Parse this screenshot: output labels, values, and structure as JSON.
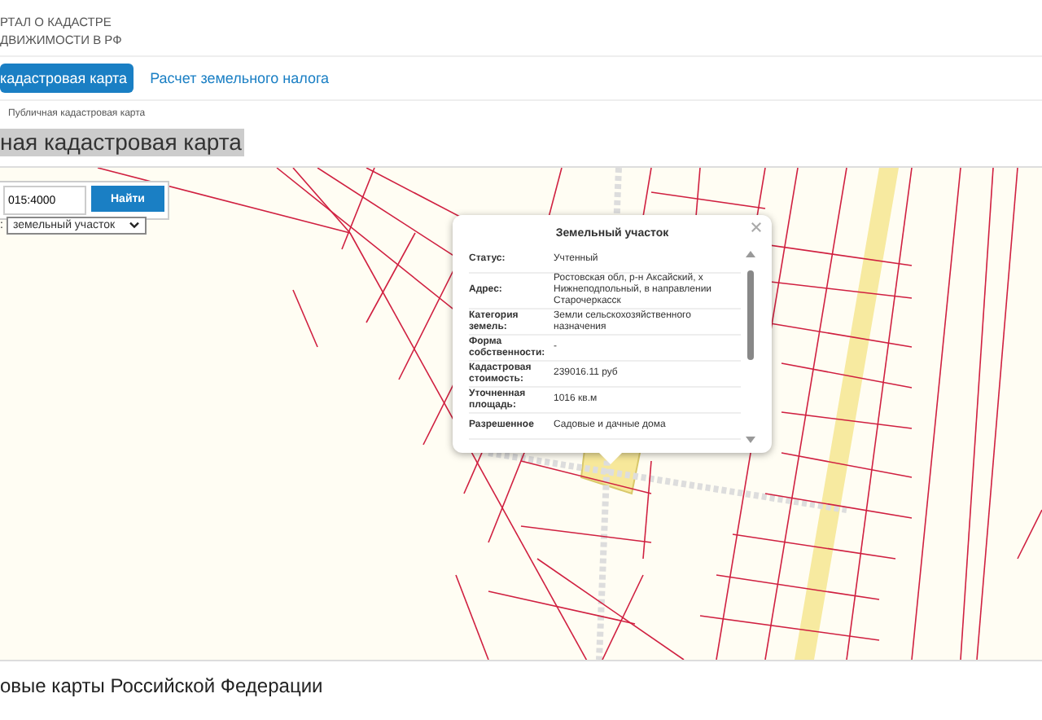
{
  "header": {
    "logo_lines": [
      "РТАЛ О КАДАСТРЕ",
      "ДВИЖИМОСТИ В РФ"
    ]
  },
  "nav": [
    {
      "label": "кадастровая карта",
      "selected": true
    },
    {
      "label": "Расчет земельного налога",
      "selected": false
    }
  ],
  "breadcrumb": "Публичная кадастровая карта",
  "heading": "ная кадастровая карта",
  "search": {
    "value": "015:4000",
    "button": "Найти",
    "select_prefix": ":",
    "select_value": "земельный участок"
  },
  "popup": {
    "title": "Земельный участок",
    "rows": [
      {
        "label": "Статус:",
        "value": "Учтенный"
      },
      {
        "label": "Адрес:",
        "value": "Ростовская обл, р-н Аксайский, х Нижнеподпольный, в направлении Старочеркасск"
      },
      {
        "label": "Категория земель:",
        "value": "Земли сельскохозяйственного назначения"
      },
      {
        "label": "Форма собственности:",
        "value": "-"
      },
      {
        "label": "Кадастровая стоимость:",
        "value": "239016.11 руб"
      },
      {
        "label": "Уточненная площадь:",
        "value": "1016 кв.м"
      },
      {
        "label": "Разрешенное",
        "value": "Садовые и дачные дома"
      }
    ]
  },
  "footer_heading": "овые карты Российской Федерации"
}
